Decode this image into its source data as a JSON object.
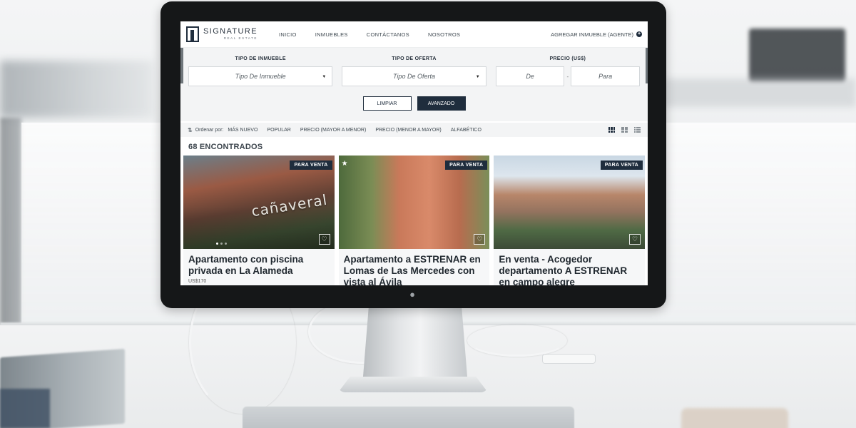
{
  "nav": {
    "logo_name": "SIGNATURE",
    "logo_sub": "REAL ESTATE",
    "links": [
      "INICIO",
      "INMUEBLES",
      "CONTÁCTANOS",
      "NOSOTROS"
    ],
    "add_property": "AGREGAR INMUEBLE (AGENTE)"
  },
  "filters": {
    "type_label": "TIPO DE INMUEBLE",
    "type_value": "Tipo De Inmueble",
    "offer_label": "TIPO DE OFERTA",
    "offer_value": "Tipo De Oferta",
    "price_label": "PRECIO (US$)",
    "price_from": "De",
    "price_to": "Para",
    "clear_button": "LIMPIAR",
    "advanced_button": "AVANZADO"
  },
  "sort": {
    "label": "Ordenar por:",
    "options": [
      "MÁS NUEVO",
      "POPULAR",
      "PRECIO (MAYOR A MENOR)",
      "PRECIO (MENOR A MAYOR)",
      "ALFABÉTICO"
    ]
  },
  "results": {
    "count_text": "68 ENCONTRADOS"
  },
  "listings": [
    {
      "badge": "PARA VENTA",
      "title": "Apartamento con piscina privada en La Alameda",
      "price": "US$170",
      "sign": "cañaveral"
    },
    {
      "badge": "PARA VENTA",
      "title": "Apartamento a ESTRENAR en Lomas de Las Mercedes con vista al Ávila",
      "price": ""
    },
    {
      "badge": "PARA VENTA",
      "title": "En venta - Acogedor departamento A ESTRENAR en campo alegre",
      "price": ""
    }
  ],
  "colors": {
    "brand_navy": "#1f2d3d",
    "panel_gray": "#f3f4f5"
  }
}
